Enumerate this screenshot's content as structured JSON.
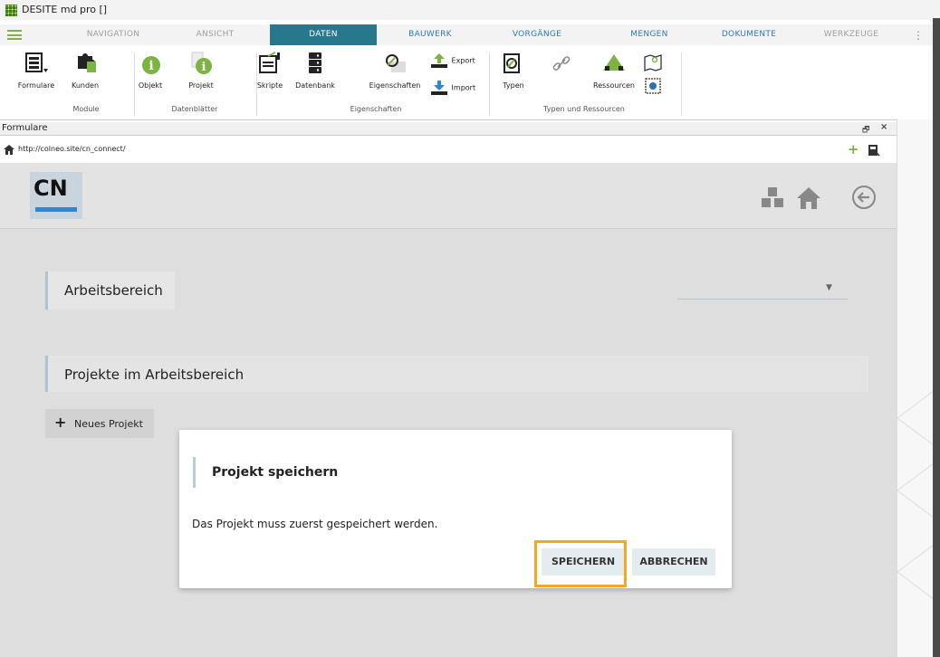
{
  "window": {
    "title": "DESITE md pro []"
  },
  "tabs": [
    {
      "label": "NAVIGATION",
      "style": "inactive"
    },
    {
      "label": "ANSICHT",
      "style": "inactive"
    },
    {
      "label": "DATEN",
      "style": "active"
    },
    {
      "label": "BAUWERK",
      "style": "blue"
    },
    {
      "label": "VORGÄNGE",
      "style": "blue"
    },
    {
      "label": "MENGEN",
      "style": "blue"
    },
    {
      "label": "DOKUMENTE",
      "style": "blue"
    },
    {
      "label": "WERKZEUGE",
      "style": "inactive"
    }
  ],
  "ribbon": {
    "buttons": {
      "formulare": "Formulare",
      "kunden": "Kunden",
      "objekt": "Objekt",
      "projekt": "Projekt",
      "skripte": "Skripte",
      "datenbank": "Datenbank",
      "eigenschaften": "Eigenschaften",
      "export": "Export",
      "import": "Import",
      "typen": "Typen",
      "ressourcen": "Ressourcen"
    },
    "groups": {
      "module": "Module",
      "datenblaetter": "Datenblätter",
      "eigenschaften": "Eigenschaften",
      "typen_ressourcen": "Typen und Ressourcen"
    }
  },
  "panel": {
    "title": "Formulare",
    "url": "http://colneo.site/cn_connect/"
  },
  "app": {
    "logo_text": "CN",
    "section_workspace": "Arbeitsbereich",
    "section_projects": "Projekte im Arbeitsbereich",
    "new_project": "Neues Projekt"
  },
  "dialog": {
    "title": "Projekt speichern",
    "message": "Das Projekt muss zuerst gespeichert werden.",
    "save": "SPEICHERN",
    "cancel": "ABBRECHEN"
  },
  "colors": {
    "accent_green": "#7cb342",
    "tab_active": "#26788a",
    "tab_blue": "#2a7ab8",
    "highlight": "#f5a623"
  }
}
